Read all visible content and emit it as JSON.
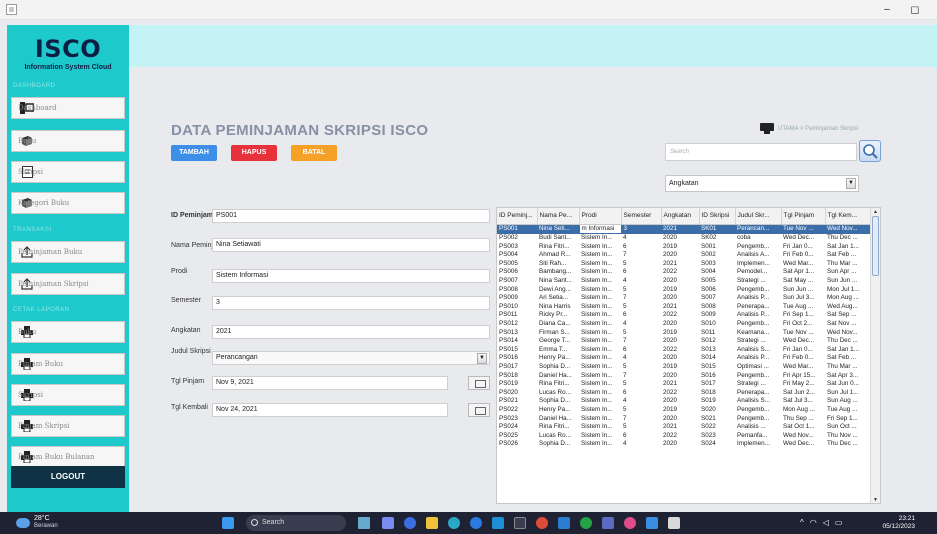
{
  "window": {
    "minimize": "−",
    "maximize": "◻"
  },
  "sidebar": {
    "logo_title": "ISCO",
    "logo_subtitle": "Information System Cloud",
    "sections": [
      "DASHBOARD",
      "TRANSAKSI",
      "CETAK LAPORAN"
    ],
    "items": [
      {
        "label": "Dashboard",
        "icon": "dashboard-icon"
      },
      {
        "label": "Buku",
        "icon": "book-icon"
      },
      {
        "label": "Skripsi",
        "icon": "document-icon"
      },
      {
        "label": "Kategori Buku",
        "icon": "category-icon"
      },
      {
        "label": "Peminjaman Buku",
        "icon": "upload-icon"
      },
      {
        "label": "Peminjaman Skripsi",
        "icon": "upload-icon"
      },
      {
        "label": "Buku",
        "icon": "printer-icon"
      },
      {
        "label": "Pinjam Buku",
        "icon": "printer-icon"
      },
      {
        "label": "Skripsi",
        "icon": "printer-icon"
      },
      {
        "label": "Pinjam Skripsi",
        "icon": "printer-icon"
      },
      {
        "label": "Pinjam Buku Bulanan",
        "icon": "printer-icon"
      }
    ],
    "logout": "LOGOUT"
  },
  "main": {
    "title": "DATA PEMINJAMAN SKRIPSI ISCO",
    "breadcrumb": "UTAMA > Peminjaman Skripsi",
    "buttons": {
      "add": "TAMBAH",
      "delete": "HAPUS",
      "cancel": "BATAL"
    },
    "search_placeholder": "Search",
    "filter_value": "Angkatan",
    "colors": {
      "add": "#3d8ee6",
      "delete": "#e8323b",
      "cancel": "#f5a027"
    }
  },
  "form": {
    "id_label": "ID Peminjaman",
    "id_value": "PS001",
    "name_label": "Nama Peminjam",
    "name_value": "Nina Setiawati",
    "prodi_label": "Prodi",
    "prodi_value": "Sistem Informasi",
    "semester_label": "Semester",
    "semester_value": "3",
    "angkatan_label": "Angkatan",
    "angkatan_value": "2021",
    "judul_label": "Judul Skripsi",
    "judul_value": "Perancangan",
    "pinjam_label": "Tgl Pinjam",
    "pinjam_value": "Nov 9, 2021",
    "kembali_label": "Tgl Kembali",
    "kembali_value": "Nov 24, 2021"
  },
  "table": {
    "columns": [
      "ID Peminj...",
      "Nama Pe...",
      "Prodi",
      "Semester",
      "Angkatan",
      "ID Skripsi",
      "Judul Skr...",
      "Tgl Pinjam",
      "Tgl Kem..."
    ],
    "rows": [
      [
        "PS001",
        "Nina Seti...",
        "m Informasi",
        "3",
        "2021",
        "SK01",
        "Perancan...",
        "Tue Nov ...",
        "Wed Nov..."
      ],
      [
        "PS002",
        "Budi Sant...",
        "Sistem In...",
        "4",
        "2020",
        "SK02",
        "coba",
        "Wed Dec...",
        "Thu Dec ..."
      ],
      [
        "PS003",
        "Rina Fitri...",
        "Sistem In...",
        "6",
        "2019",
        "S001",
        "Pengemb...",
        "Fri Jan 0...",
        "Sat Jan 1..."
      ],
      [
        "PS004",
        "Ahmad R...",
        "Sistem In...",
        "7",
        "2020",
        "S002",
        "Analisis A...",
        "Fri Feb 0...",
        "Sat Feb ..."
      ],
      [
        "PS005",
        "Siti Rah...",
        "Sistem In...",
        "5",
        "2021",
        "S003",
        "Implemen...",
        "Wed Mar...",
        "Thu Mar ..."
      ],
      [
        "PS006",
        "Bambang...",
        "Sistem In...",
        "6",
        "2022",
        "S004",
        "Pemodel...",
        "Sat Apr 1...",
        "Sun Apr ..."
      ],
      [
        "PS007",
        "Nina Sant...",
        "Sistem In...",
        "4",
        "2020",
        "S005",
        "Strategi ...",
        "Sat May ...",
        "Sun Jun ..."
      ],
      [
        "PS008",
        "Dewi Ang...",
        "Sistem In...",
        "5",
        "2019",
        "S006",
        "Pengemb...",
        "Sun Jun ...",
        "Mon Jul 1..."
      ],
      [
        "PS009",
        "Ari Setia...",
        "Sistem In...",
        "7",
        "2020",
        "S007",
        "Analisis P...",
        "Sun Jul 3...",
        "Mon Aug ..."
      ],
      [
        "PS010",
        "Nina Harris",
        "Sistem In...",
        "5",
        "2021",
        "S008",
        "Penerapa...",
        "Tue Aug ...",
        "Wed Aug..."
      ],
      [
        "PS011",
        "Ricky Pr...",
        "Sistem In...",
        "6",
        "2022",
        "S009",
        "Analisis P...",
        "Fri Sep 1...",
        "Sat Sep ..."
      ],
      [
        "PS012",
        "Diana Ca...",
        "Sistem In...",
        "4",
        "2020",
        "S010",
        "Pengemb...",
        "Fri Oct 2...",
        "Sat Nov ..."
      ],
      [
        "PS013",
        "Firman S...",
        "Sistem In...",
        "5",
        "2019",
        "S011",
        "Keamana...",
        "Tue Nov ...",
        "Wed Nov..."
      ],
      [
        "PS014",
        "George T...",
        "Sistem In...",
        "7",
        "2020",
        "S012",
        "Strategi ...",
        "Wed Dec...",
        "Thu Dec ..."
      ],
      [
        "PS015",
        "Emma T...",
        "Sistem In...",
        "6",
        "2022",
        "S013",
        "Analisis S...",
        "Fri Jan 0...",
        "Sat Jan 1..."
      ],
      [
        "PS016",
        "Henry Pa...",
        "Sistem In...",
        "4",
        "2020",
        "S014",
        "Analisis P...",
        "Fri Feb 0...",
        "Sat Feb ..."
      ],
      [
        "PS017",
        "Sophia D...",
        "Sistem In...",
        "5",
        "2019",
        "S015",
        "Optimasi ...",
        "Wed Mar...",
        "Thu Mar ..."
      ],
      [
        "PS018",
        "Daniel Ha...",
        "Sistem In...",
        "7",
        "2020",
        "S016",
        "Pengemb...",
        "Fri Apr 15...",
        "Sat Apr 3..."
      ],
      [
        "PS019",
        "Rina Fitri...",
        "Sistem In...",
        "5",
        "2021",
        "S017",
        "Strategi ...",
        "Fri May 2...",
        "Sat Jun 0..."
      ],
      [
        "PS020",
        "Lucas Ro...",
        "Sistem In...",
        "6",
        "2022",
        "S018",
        "Penerapa...",
        "Sat Jun 2...",
        "Sun Jul 1..."
      ],
      [
        "PS021",
        "Sophia D...",
        "Sistem In...",
        "4",
        "2020",
        "S019",
        "Analisis S...",
        "Sat Jul 3...",
        "Sun Aug ..."
      ],
      [
        "PS022",
        "Henry Pa...",
        "Sistem In...",
        "5",
        "2019",
        "S020",
        "Pengemb...",
        "Mon Aug ...",
        "Tue Aug ..."
      ],
      [
        "PS023",
        "Daniel Ha...",
        "Sistem In...",
        "7",
        "2020",
        "S021",
        "Pengemb...",
        "Thu Sep ...",
        "Fri Sep 1..."
      ],
      [
        "PS024",
        "Rina Fitri...",
        "Sistem In...",
        "5",
        "2021",
        "S022",
        "Analisis ...",
        "Sat Oct 1...",
        "Sun Oct ..."
      ],
      [
        "PS025",
        "Lucas Ro...",
        "Sistem In...",
        "6",
        "2022",
        "S023",
        "Pemanfa...",
        "Wed Nov...",
        "Thu Nov ..."
      ],
      [
        "PS026",
        "Sophia D...",
        "Sistem In...",
        "4",
        "2020",
        "S024",
        "Implemen...",
        "Wed Dec...",
        "Thu Dec ..."
      ]
    ]
  },
  "taskbar": {
    "temp": "28°C",
    "weather": "Berawan",
    "search": "Search",
    "time": "23:21",
    "date": "05/12/2023"
  }
}
